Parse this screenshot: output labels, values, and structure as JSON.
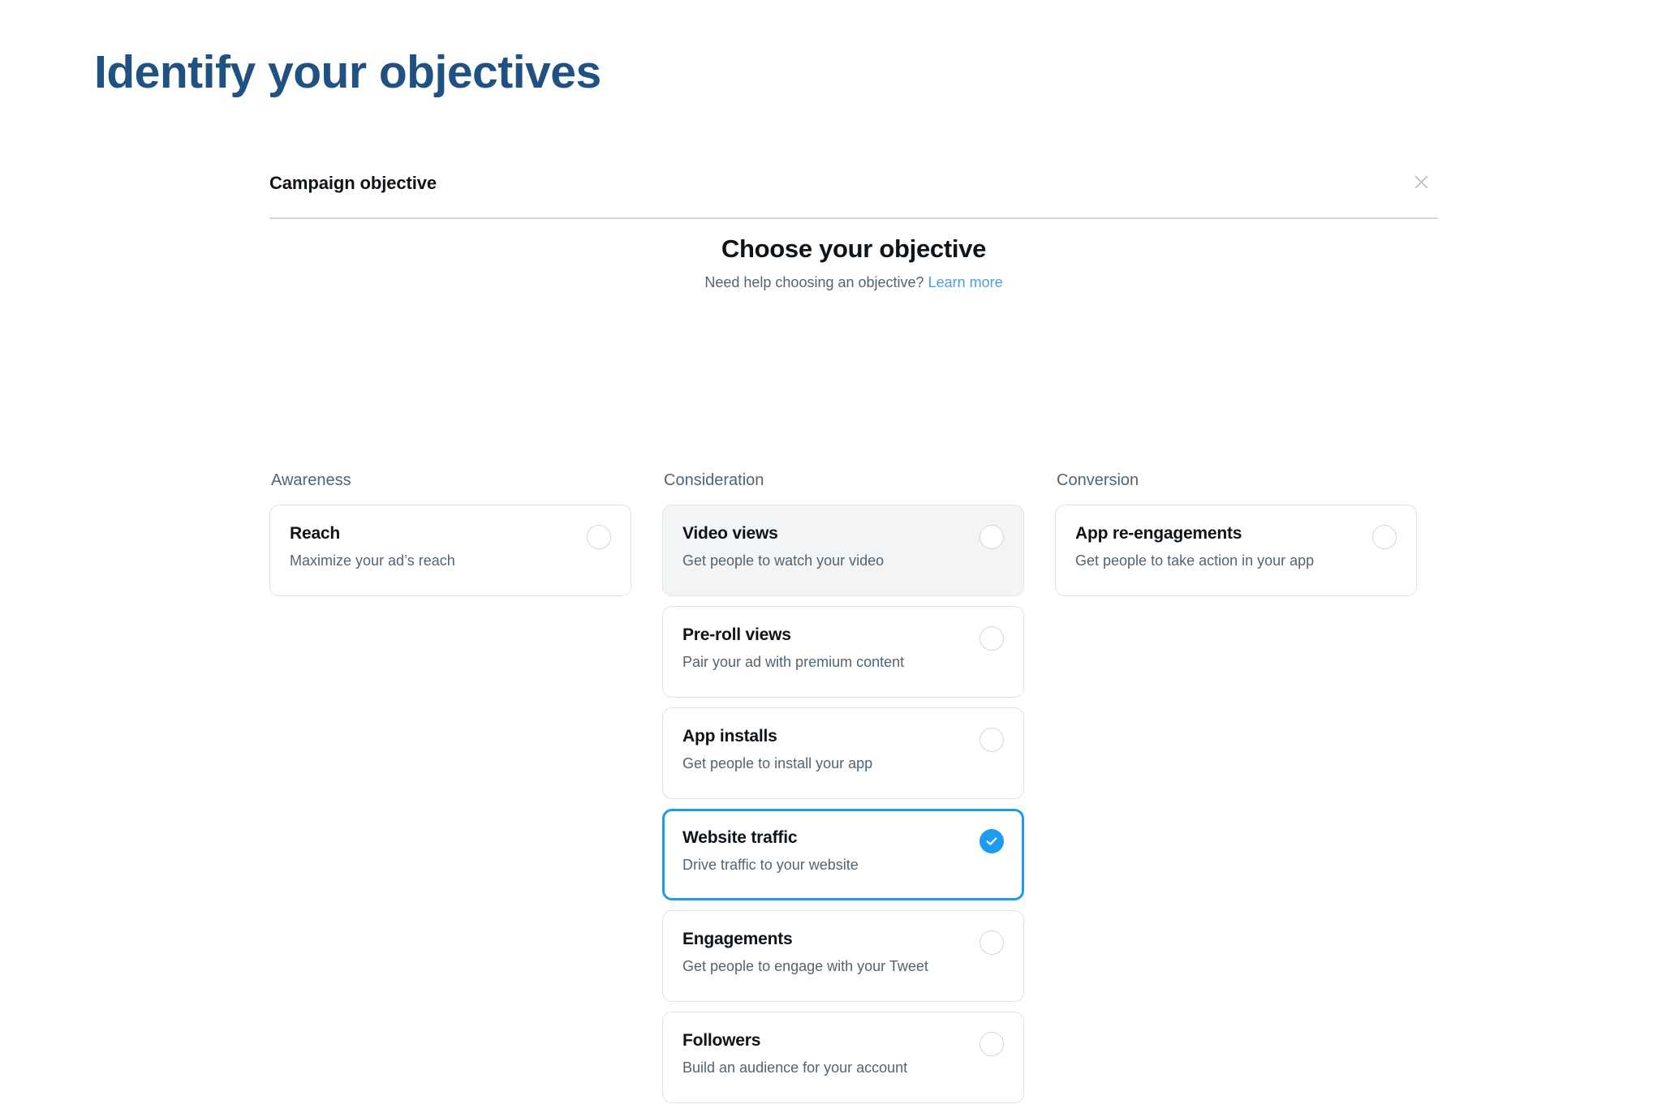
{
  "slide": {
    "title": "Identify your objectives",
    "title_color": "#1F5183"
  },
  "modal": {
    "header_title": "Campaign objective",
    "close_icon": "close-icon",
    "heading": "Choose your objective",
    "subtitle_text": "Need help choosing an objective?",
    "subtitle_link": "Learn more",
    "accent_color": "#1D9BF0",
    "link_color": "#4A9FE0"
  },
  "columns": [
    {
      "title": "Awareness",
      "cards": [
        {
          "title": "Reach",
          "desc": "Maximize your ad’s reach",
          "selected": false,
          "hovered": false
        }
      ]
    },
    {
      "title": "Consideration",
      "cards": [
        {
          "title": "Video views",
          "desc": "Get people to watch your video",
          "selected": false,
          "hovered": true
        },
        {
          "title": "Pre-roll views",
          "desc": "Pair your ad with premium content",
          "selected": false,
          "hovered": false
        },
        {
          "title": "App installs",
          "desc": "Get people to install your app",
          "selected": false,
          "hovered": false
        },
        {
          "title": "Website traffic",
          "desc": "Drive traffic to your website",
          "selected": true,
          "hovered": false
        },
        {
          "title": "Engagements",
          "desc": "Get people to engage with your Tweet",
          "selected": false,
          "hovered": false
        },
        {
          "title": "Followers",
          "desc": "Build an audience for your account",
          "selected": false,
          "hovered": false
        }
      ]
    },
    {
      "title": "Conversion",
      "cards": [
        {
          "title": "App re-engagements",
          "desc": "Get people to take action in your app",
          "selected": false,
          "hovered": false
        }
      ]
    }
  ]
}
